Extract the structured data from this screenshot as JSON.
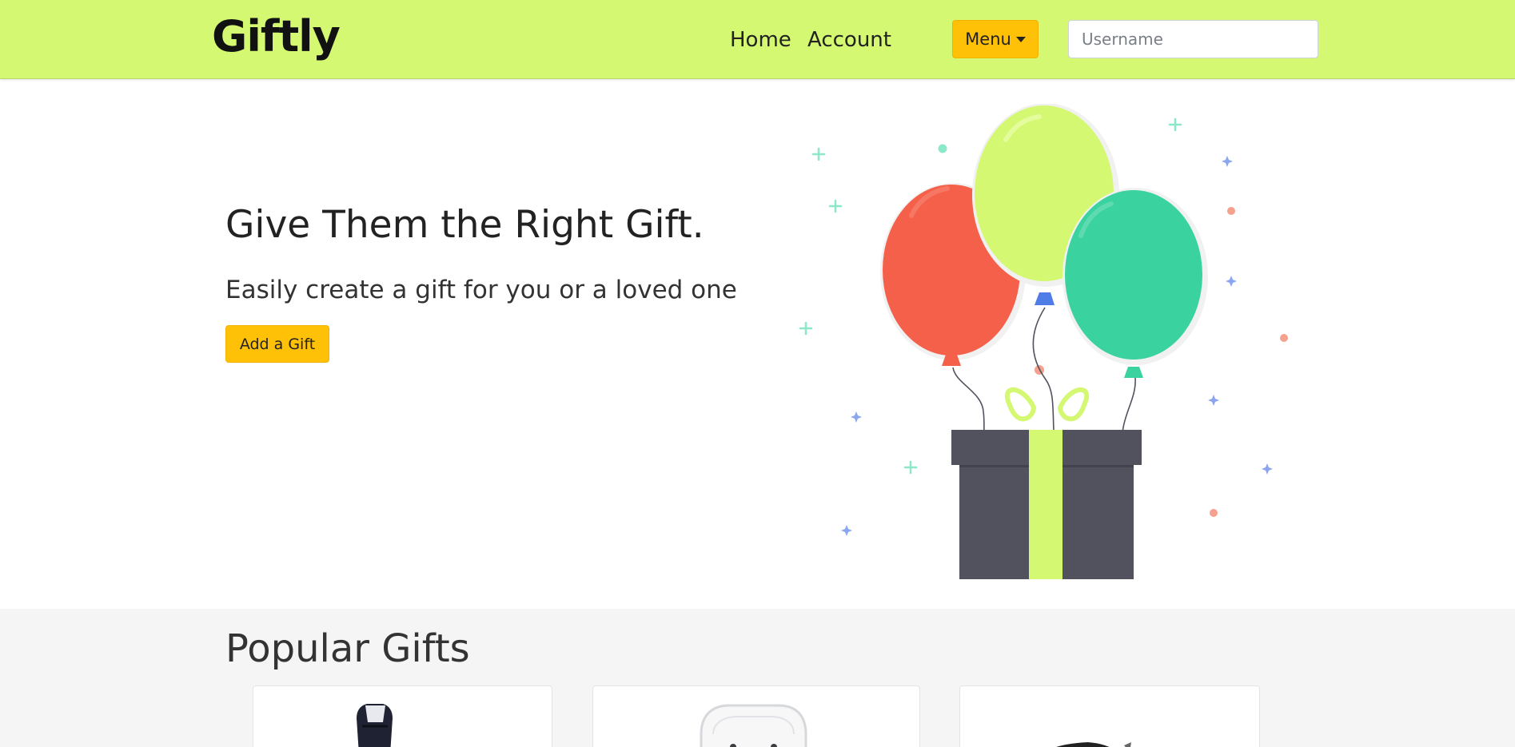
{
  "navbar": {
    "brand": "Giftly",
    "links": [
      {
        "label": "Home"
      },
      {
        "label": "Account"
      }
    ],
    "menu_label": "Menu",
    "search": {
      "placeholder": "Username",
      "value": ""
    },
    "background": "#d4f872"
  },
  "hero": {
    "title": "Give Them the Right Gift.",
    "subtitle": "Easily create a gift for you or a loved one",
    "add_button": "Add a Gift",
    "button_color": "#ffc107"
  },
  "illustration": {
    "balloon_colors": [
      "#f5604a",
      "#d4f872",
      "#3ad29f"
    ],
    "gift_box_color": "#52525e",
    "ribbon_color": "#d4f872"
  },
  "popular": {
    "title": "Popular Gifts",
    "cards": [
      {
        "image": "headphones-image"
      },
      {
        "image": "earbuds-image"
      },
      {
        "image": "gift-item-image"
      }
    ]
  }
}
